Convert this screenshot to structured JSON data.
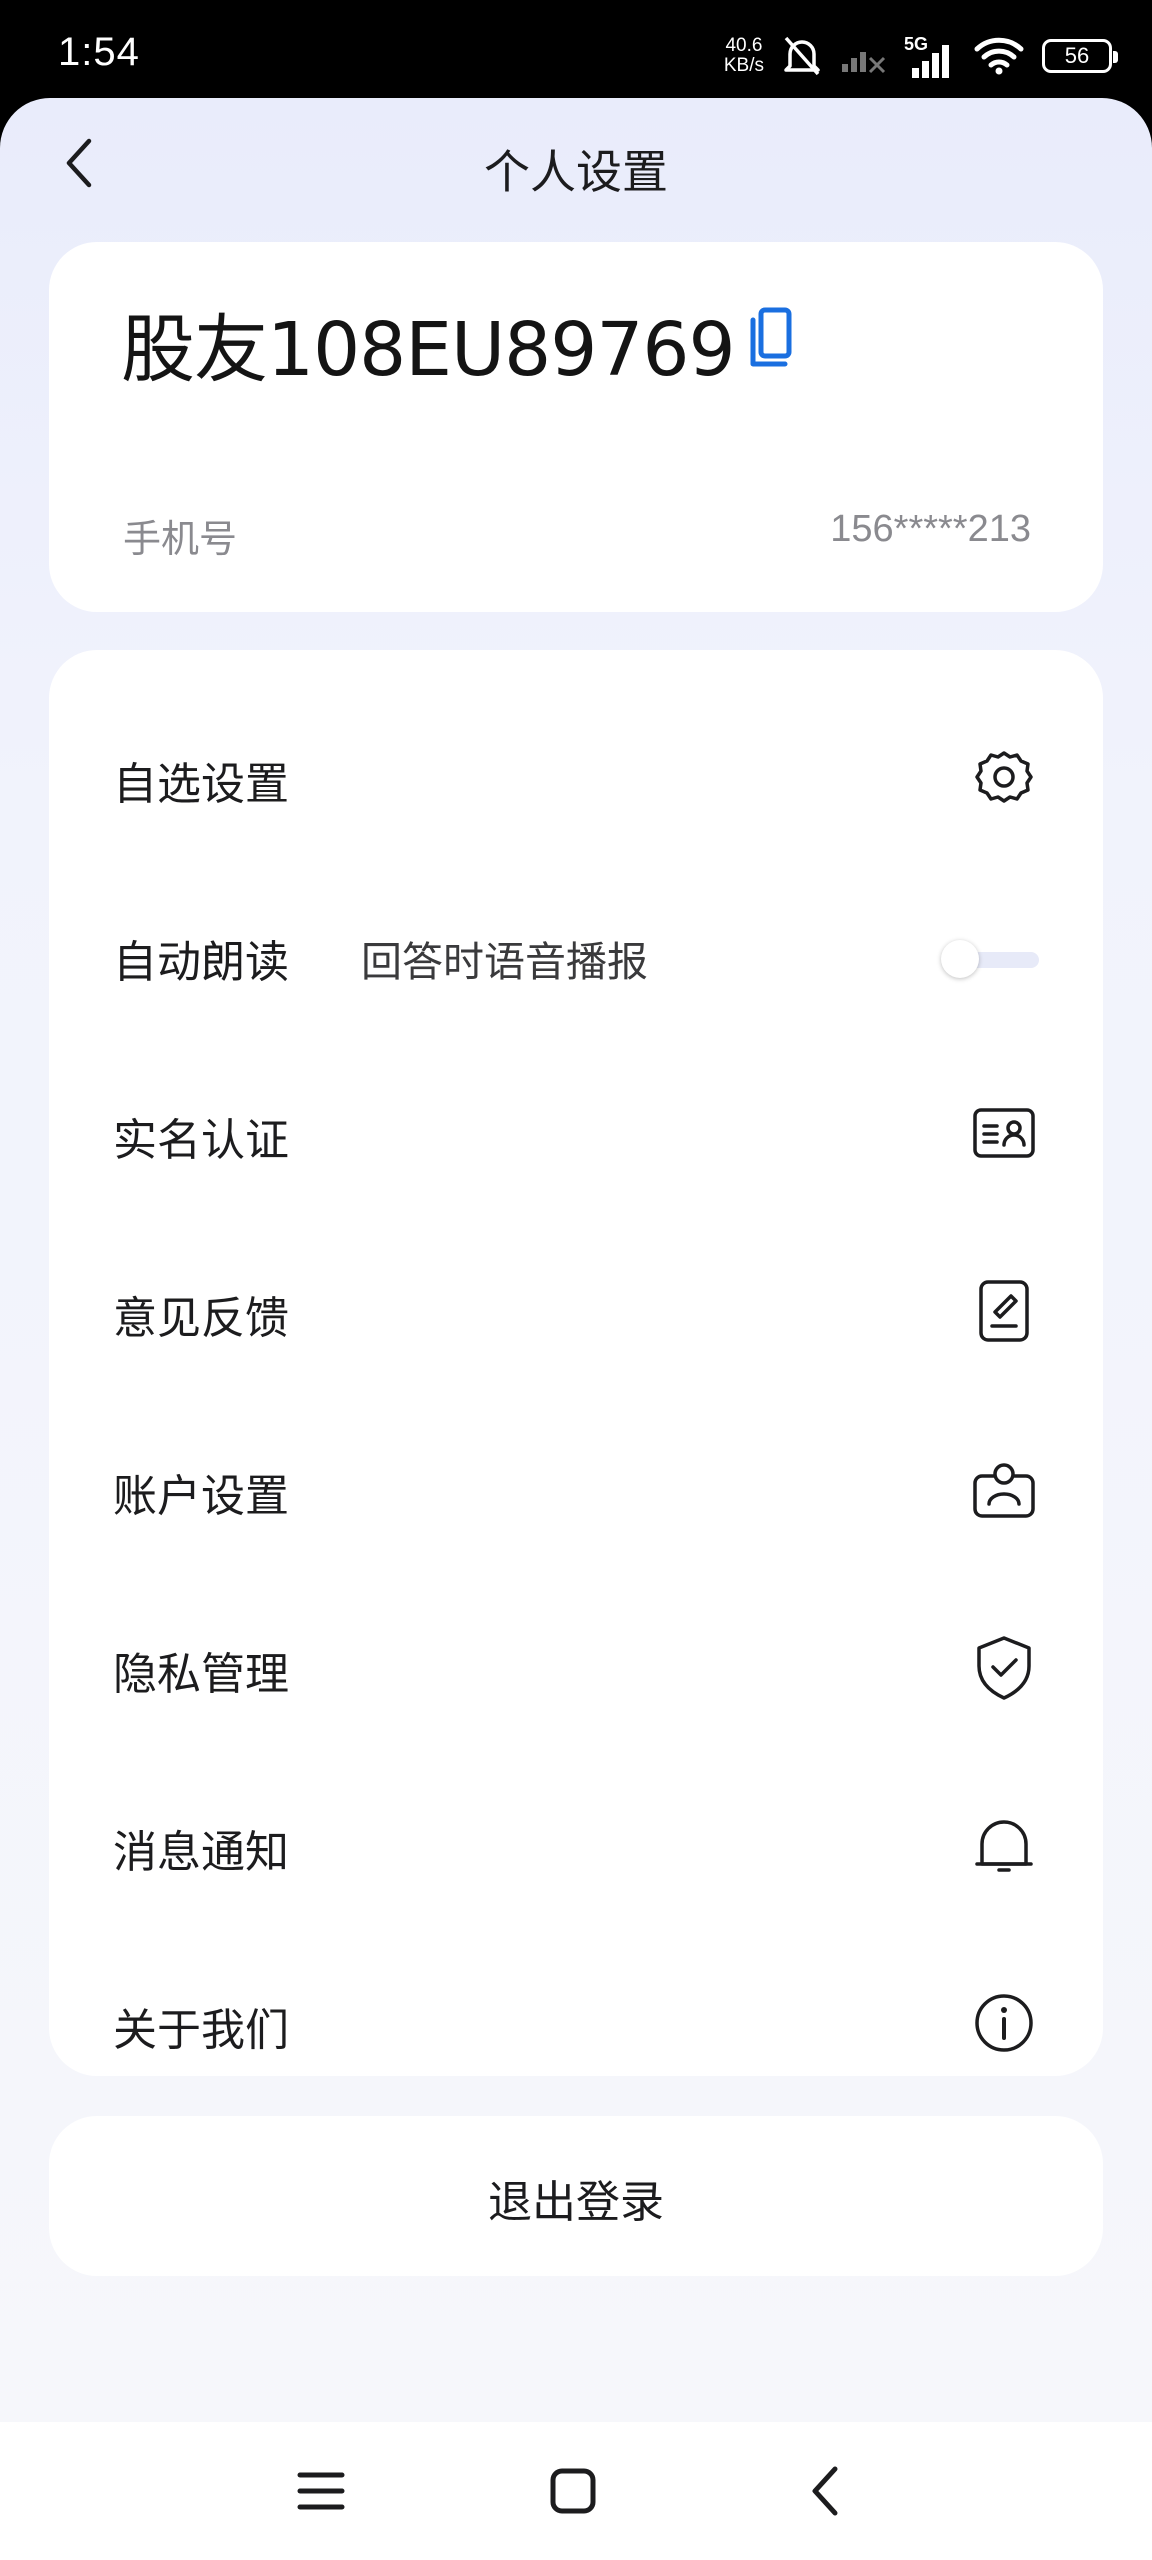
{
  "status_bar": {
    "time": "1:54",
    "speed_value": "40.6",
    "speed_unit": "KB/s",
    "network": "5G",
    "battery": "56"
  },
  "header": {
    "title": "个人设置",
    "back_icon": "chevron-left-icon"
  },
  "profile": {
    "username": "股友108EU89769",
    "copy_icon": "copy-icon",
    "phone_label": "手机号",
    "phone_value": "156*****213"
  },
  "menu": {
    "items": [
      {
        "label": "自选设置",
        "icon": "gear-icon"
      },
      {
        "label": "自动朗读",
        "sublabel": "回答时语音播报",
        "toggle_on": false
      },
      {
        "label": "实名认证",
        "icon": "id-card-icon"
      },
      {
        "label": "意见反馈",
        "icon": "feedback-edit-icon"
      },
      {
        "label": "账户设置",
        "icon": "account-icon"
      },
      {
        "label": "隐私管理",
        "icon": "shield-check-icon"
      },
      {
        "label": "消息通知",
        "icon": "bell-icon"
      },
      {
        "label": "关于我们",
        "icon": "info-icon"
      }
    ]
  },
  "logout": {
    "label": "退出登录"
  },
  "colors": {
    "accent": "#1a6fe0",
    "background_top": "#e9ecfb",
    "card": "#ffffff",
    "muted_text": "#8a8a8f"
  },
  "nav_bar": {
    "menu_icon": "menu-icon",
    "home_icon": "home-square-icon",
    "back_icon": "back-triangle-icon"
  }
}
